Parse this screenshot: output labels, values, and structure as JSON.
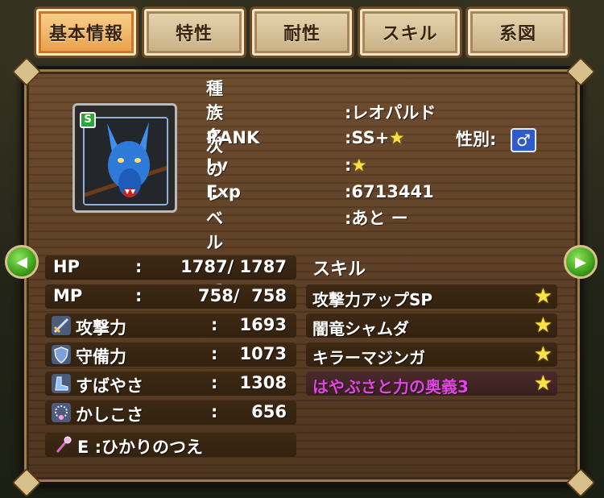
{
  "tabs": [
    {
      "label": "基本情報",
      "active": true
    },
    {
      "label": "特性",
      "active": false
    },
    {
      "label": "耐性",
      "active": false
    },
    {
      "label": "スキル",
      "active": false
    },
    {
      "label": "系図",
      "active": false
    }
  ],
  "portrait": {
    "badge": "S"
  },
  "info": {
    "species_label": "種族名",
    "species_value": ":レオパルド",
    "rank_label": "RANK",
    "rank_value": ":SS+",
    "rank_star": "★",
    "gender_label": "性別:",
    "gender_symbol": "♂",
    "lv_label": "Lv",
    "lv_value": ":",
    "lv_star": "★",
    "exp_label": "Exp",
    "exp_value": ":6713441",
    "next_label": "次のレベルまで",
    "next_value": ":あと  ー"
  },
  "stats": {
    "hp": {
      "label": "HP",
      "colon": ":",
      "value": "1787/ 1787"
    },
    "mp": {
      "label": "MP",
      "colon": ":",
      "value": "758/  758"
    },
    "attack": {
      "label": "攻撃力",
      "colon": ":",
      "value": "1693"
    },
    "defense": {
      "label": "守備力",
      "colon": ":",
      "value": "1073"
    },
    "speed": {
      "label": "すばやさ",
      "colon": ":",
      "value": "1308"
    },
    "wisdom": {
      "label": "かしこさ",
      "colon": ":",
      "value": "656"
    }
  },
  "equip": {
    "label": "E :ひかりのつえ"
  },
  "skills": {
    "title": "スキル",
    "items": [
      {
        "name": "攻撃力アップSP",
        "star": "★"
      },
      {
        "name": "闇竜シャムダ",
        "star": "★"
      },
      {
        "name": "キラーマジンガ",
        "star": "★"
      },
      {
        "name": "はやぶさと力の奥義3",
        "star": "★"
      }
    ]
  },
  "icons": {
    "arrow_left": "chevron-left-icon",
    "arrow_right": "chevron-right-icon",
    "attack": "sword-icon",
    "defense": "shield-icon",
    "speed": "boots-icon",
    "wisdom": "necklace-icon",
    "equip": "staff-icon"
  },
  "colors": {
    "accent_tab": "#e79b46",
    "special_skill": "#e145e4",
    "arrow_green": "#3ea11b"
  }
}
